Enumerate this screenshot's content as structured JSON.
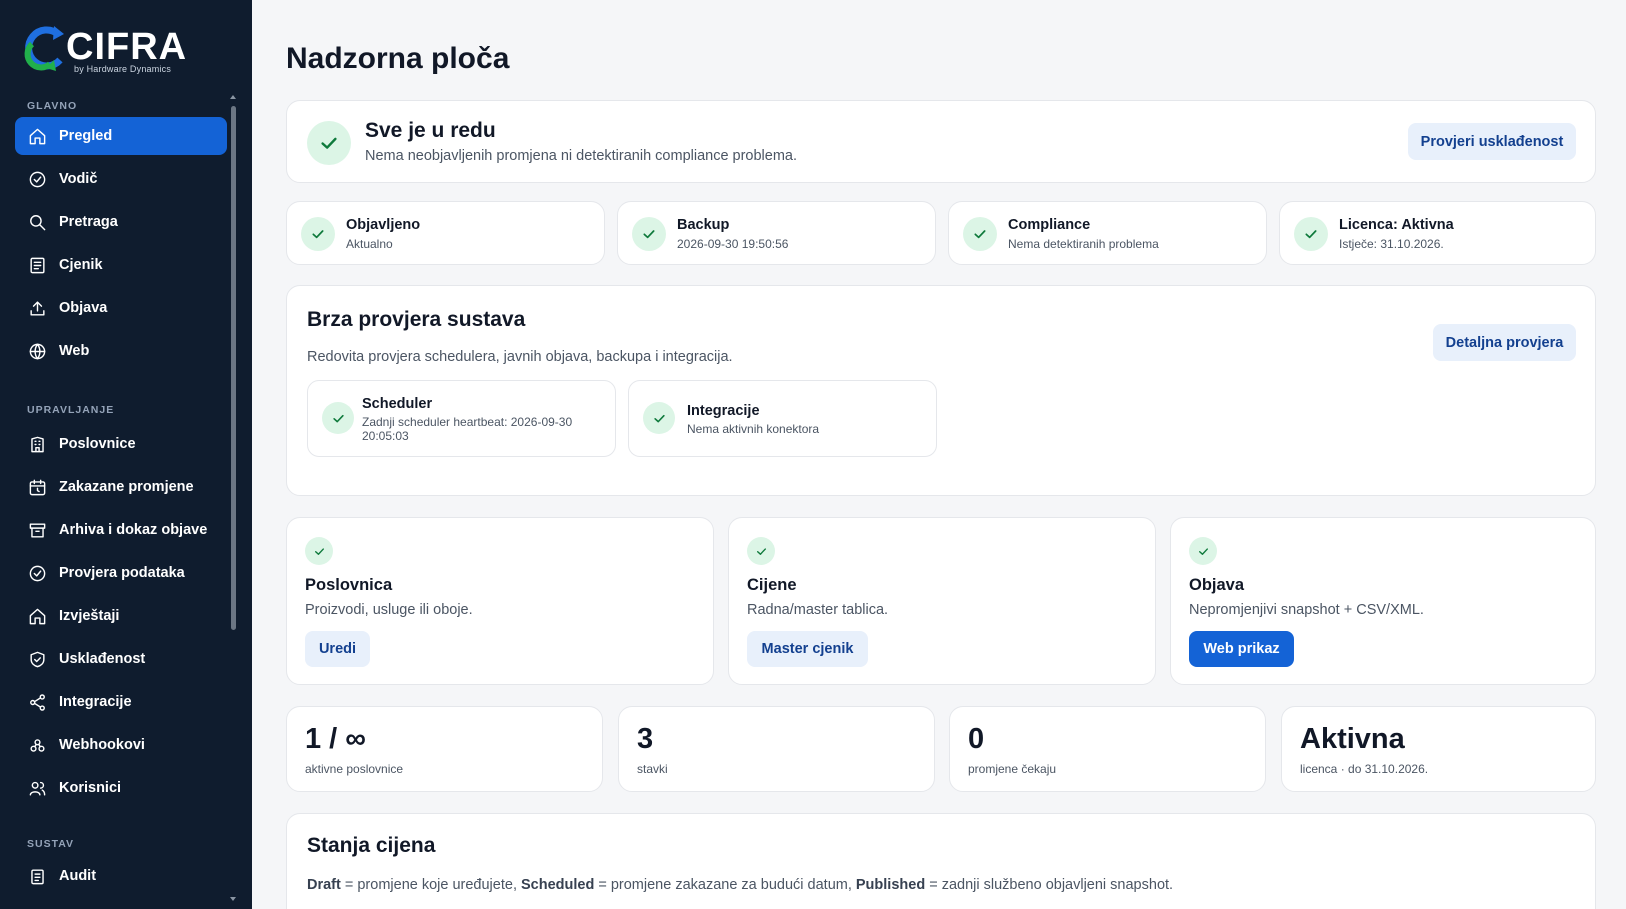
{
  "brand": {
    "name": "CIFRA",
    "tagline": "by Hardware Dynamics"
  },
  "sidebar": {
    "sections": [
      {
        "label": "GLAVNO"
      },
      {
        "label": "UPRAVLJANJE"
      },
      {
        "label": "SUSTAV"
      }
    ],
    "items": [
      {
        "label": "Pregled",
        "icon": "home-icon",
        "active": true
      },
      {
        "label": "Vodič",
        "icon": "check-circle-icon"
      },
      {
        "label": "Pretraga",
        "icon": "search-icon"
      },
      {
        "label": "Cjenik",
        "icon": "document-icon"
      },
      {
        "label": "Objava",
        "icon": "upload-icon"
      },
      {
        "label": "Web",
        "icon": "globe-icon"
      },
      {
        "label": "Poslovnice",
        "icon": "building-icon"
      },
      {
        "label": "Zakazane promjene",
        "icon": "calendar-icon"
      },
      {
        "label": "Arhiva i dokaz objave",
        "icon": "archive-icon"
      },
      {
        "label": "Provjera podataka",
        "icon": "check-circle-icon"
      },
      {
        "label": "Izvještaji",
        "icon": "home-icon"
      },
      {
        "label": "Usklađenost",
        "icon": "shield-check-icon"
      },
      {
        "label": "Integracije",
        "icon": "share-icon"
      },
      {
        "label": "Webhookovi",
        "icon": "webhook-icon"
      },
      {
        "label": "Korisnici",
        "icon": "users-icon"
      },
      {
        "label": "Audit",
        "icon": "clipboard-icon"
      }
    ]
  },
  "page": {
    "title": "Nadzorna ploča"
  },
  "status_banner": {
    "title": "Sve je u redu",
    "subtitle": "Nema neobjavljenih promjena ni detektiranih compliance problema.",
    "button": "Provjeri usklađenost"
  },
  "status_cards": [
    {
      "title": "Objavljeno",
      "detail": "Aktualno"
    },
    {
      "title": "Backup",
      "detail": "2026-09-30 19:50:56"
    },
    {
      "title": "Compliance",
      "detail": "Nema detektiranih problema"
    },
    {
      "title": "Licenca: Aktivna",
      "detail": "Istječe: 31.10.2026."
    }
  ],
  "quick_check": {
    "title": "Brza provjera sustava",
    "subtitle": "Redovita provjera schedulera, javnih objava, backupa i integracija.",
    "button": "Detaljna provjera",
    "items": [
      {
        "title": "Scheduler",
        "detail_line1": "Zadnji scheduler heartbeat: 2026-09-30",
        "detail_line2": "20:05:03"
      },
      {
        "title": "Integracije",
        "detail_line1": "Nema aktivnih konektora"
      }
    ]
  },
  "steps": [
    {
      "title": "Poslovnica",
      "detail": "Proizvodi, usluge ili oboje.",
      "button": "Uredi",
      "primary": false
    },
    {
      "title": "Cijene",
      "detail": "Radna/master tablica.",
      "button": "Master cjenik",
      "primary": false
    },
    {
      "title": "Objava",
      "detail": "Nepromjenjivi snapshot + CSV/XML.",
      "button": "Web prikaz",
      "primary": true
    }
  ],
  "stats": [
    {
      "value": "1 / ∞",
      "label": "aktivne poslovnice"
    },
    {
      "value": "3",
      "label": "stavki"
    },
    {
      "value": "0",
      "label": "promjene čekaju"
    },
    {
      "value": "Aktivna",
      "label": "licenca · do 31.10.2026."
    }
  ],
  "price_states": {
    "title": "Stanja cijena",
    "draft_term": "Draft",
    "draft_text": " = promjene koje uređujete, ",
    "scheduled_term": "Scheduled",
    "scheduled_text": " = promjene zakazane za budući datum, ",
    "published_term": "Published",
    "published_text": " = zadnji službeno objavljeni snapshot."
  },
  "colors": {
    "sidebar_bg": "#0f1c2e",
    "accent": "#1463d6",
    "success": "#0f7a3c",
    "success_bg": "#dcf5e6"
  }
}
